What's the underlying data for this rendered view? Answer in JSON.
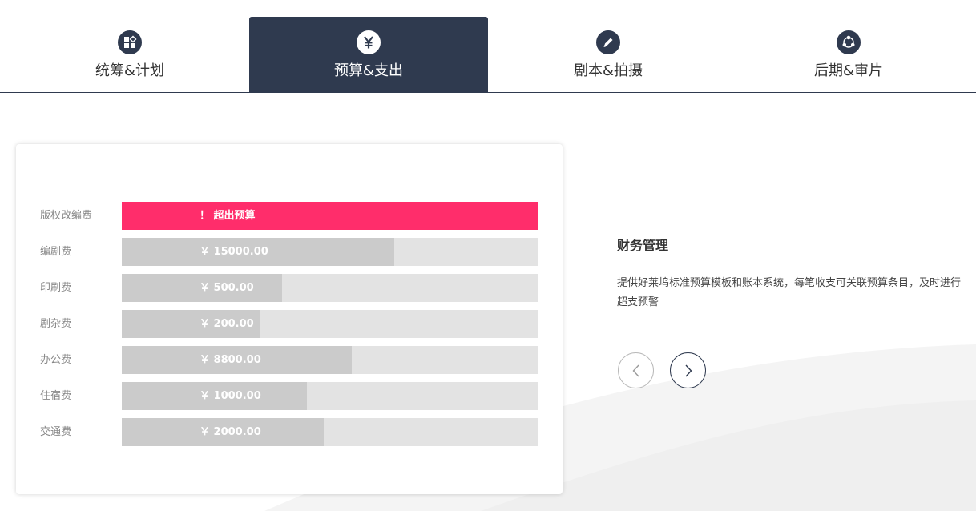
{
  "tabs": [
    {
      "label": "统筹&计划",
      "icon": "grid-shapes-icon",
      "active": false
    },
    {
      "label": "预算&支出",
      "icon": "yen-icon",
      "active": true
    },
    {
      "label": "剧本&拍摄",
      "icon": "pencil-icon",
      "active": false
    },
    {
      "label": "后期&审片",
      "icon": "share-nodes-icon",
      "active": false
    }
  ],
  "budget": {
    "rows": [
      {
        "name": "版权改编费",
        "amount": "！ 超出预算",
        "ratio": 1.0,
        "over": true
      },
      {
        "name": "编剧费",
        "amount": "￥ 15000.00",
        "ratio": 0.655,
        "over": false
      },
      {
        "name": "印刷费",
        "amount": "￥ 500.00",
        "ratio": 0.385,
        "over": false
      },
      {
        "name": "剧杂费",
        "amount": "￥ 200.00",
        "ratio": 0.333,
        "over": false
      },
      {
        "name": "办公费",
        "amount": "￥ 8800.00",
        "ratio": 0.553,
        "over": false
      },
      {
        "name": "住宿费",
        "amount": "￥ 1000.00",
        "ratio": 0.445,
        "over": false
      },
      {
        "name": "交通费",
        "amount": "￥ 2000.00",
        "ratio": 0.485,
        "over": false
      }
    ]
  },
  "info": {
    "title": "财务管理",
    "description": "提供好莱坞标准预算模板和账本系统，每笔收支可关联预算条目，及时进行超支预警"
  },
  "colors": {
    "navy": "#2f3a4f",
    "over_budget": "#ff2d6b",
    "bar_fill": "#cbcbcb",
    "bar_track": "#e3e3e3"
  }
}
